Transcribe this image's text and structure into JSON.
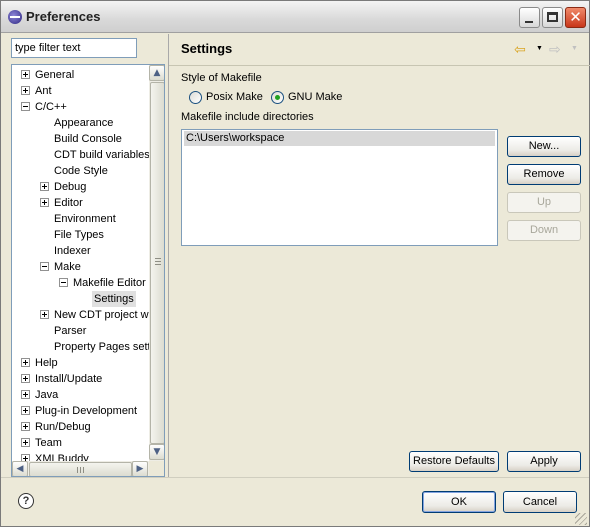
{
  "window": {
    "title": "Preferences"
  },
  "filter": {
    "placeholder": "type filter text"
  },
  "tree": [
    {
      "label": "General",
      "level": 0,
      "state": "collapsed"
    },
    {
      "label": "Ant",
      "level": 0,
      "state": "collapsed"
    },
    {
      "label": "C/C++",
      "level": 0,
      "state": "expanded"
    },
    {
      "label": "Appearance",
      "level": 1,
      "state": "leaf"
    },
    {
      "label": "Build Console",
      "level": 1,
      "state": "leaf"
    },
    {
      "label": "CDT build variables",
      "level": 1,
      "state": "leaf"
    },
    {
      "label": "Code Style",
      "level": 1,
      "state": "leaf"
    },
    {
      "label": "Debug",
      "level": 1,
      "state": "collapsed"
    },
    {
      "label": "Editor",
      "level": 1,
      "state": "collapsed"
    },
    {
      "label": "Environment",
      "level": 1,
      "state": "leaf"
    },
    {
      "label": "File Types",
      "level": 1,
      "state": "leaf"
    },
    {
      "label": "Indexer",
      "level": 1,
      "state": "leaf"
    },
    {
      "label": "Make",
      "level": 1,
      "state": "expanded"
    },
    {
      "label": "Makefile Editor",
      "level": 2,
      "state": "expanded"
    },
    {
      "label": "Settings",
      "level": 3,
      "state": "leaf",
      "selected": true
    },
    {
      "label": "New CDT project wi",
      "level": 1,
      "state": "collapsed"
    },
    {
      "label": "Parser",
      "level": 1,
      "state": "leaf"
    },
    {
      "label": "Property Pages sett",
      "level": 1,
      "state": "leaf"
    },
    {
      "label": "Help",
      "level": 0,
      "state": "collapsed"
    },
    {
      "label": "Install/Update",
      "level": 0,
      "state": "collapsed"
    },
    {
      "label": "Java",
      "level": 0,
      "state": "collapsed"
    },
    {
      "label": "Plug-in Development",
      "level": 0,
      "state": "collapsed"
    },
    {
      "label": "Run/Debug",
      "level": 0,
      "state": "collapsed"
    },
    {
      "label": "Team",
      "level": 0,
      "state": "collapsed"
    },
    {
      "label": "XMLBuddy",
      "level": 0,
      "state": "collapsed"
    }
  ],
  "page": {
    "title": "Settings",
    "makefile_style_label": "Style of Makefile",
    "radio_posix": {
      "label": "Posix Make",
      "checked": false
    },
    "radio_gnu": {
      "label": "GNU Make",
      "checked": true
    },
    "include_dirs_label": "Makefile include directories",
    "include_dirs": [
      "C:\\Users\\workspace"
    ],
    "buttons": {
      "new": "New...",
      "remove": "Remove",
      "up": "Up",
      "down": "Down"
    },
    "restore_defaults": "Restore Defaults",
    "apply": "Apply"
  },
  "footer": {
    "ok": "OK",
    "cancel": "Cancel",
    "help_glyph": "?"
  },
  "icons": {
    "title": "eclipse-icon",
    "back": "back-arrow-icon",
    "forward": "forward-arrow-icon",
    "help": "help-icon"
  },
  "colors": {
    "window_bg": "#ece9d8",
    "border_blue": "#7f9db9",
    "radio_dot": "#21a121",
    "back_arrow": "#d9a420"
  }
}
